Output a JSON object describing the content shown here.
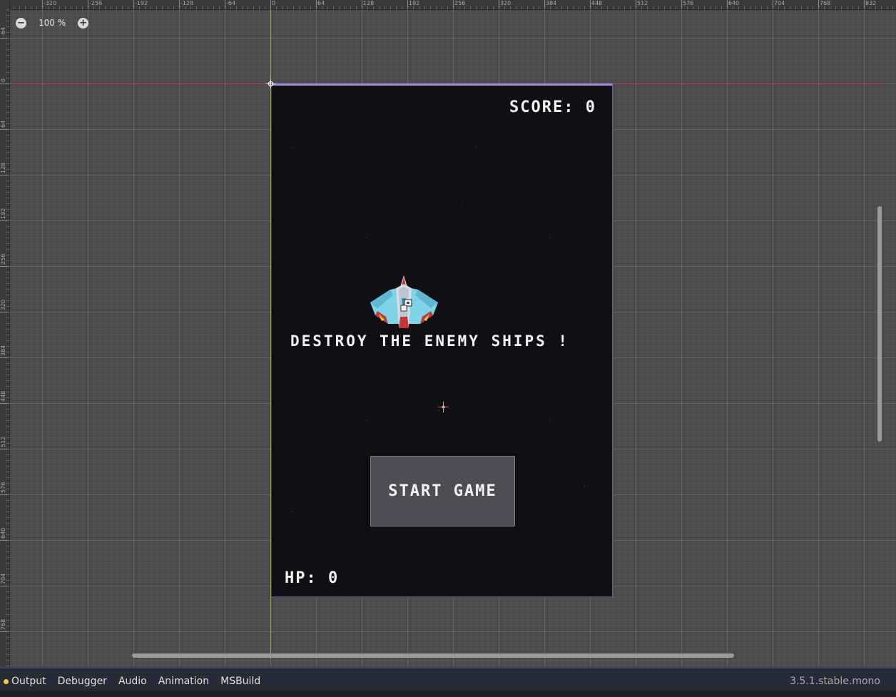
{
  "editor": {
    "zoom": {
      "minus_icon": "zoom-out-icon",
      "level": "100 %",
      "plus_icon": "zoom-in-icon"
    },
    "ruler": {
      "h_labels": [
        "-320",
        "-256",
        "-192",
        "-128",
        "-64",
        "0",
        "64",
        "128",
        "192",
        "256",
        "320",
        "384",
        "448",
        "512",
        "576",
        "640",
        "704",
        "768",
        "832"
      ],
      "v_labels": [
        "-64",
        "0",
        "64",
        "128",
        "192",
        "256",
        "320",
        "384",
        "448",
        "512",
        "576",
        "640",
        "704",
        "768"
      ]
    },
    "colors": {
      "canvas_bg": "#4b4b4b",
      "x_axis": "#c23a4f",
      "y_axis": "#8fb43a",
      "viewport_outline": "#a88be8",
      "game_bg": "#101014"
    }
  },
  "game": {
    "score": "SCORE: 0",
    "headline": "DESTROY THE ENEMY SHIPS !",
    "start_button": "START GAME",
    "hp": "HP: 0"
  },
  "bottom_panel": {
    "tabs": [
      "Output",
      "Debugger",
      "Audio",
      "Animation",
      "MSBuild"
    ],
    "version": "3.5.1.stable.mono"
  }
}
